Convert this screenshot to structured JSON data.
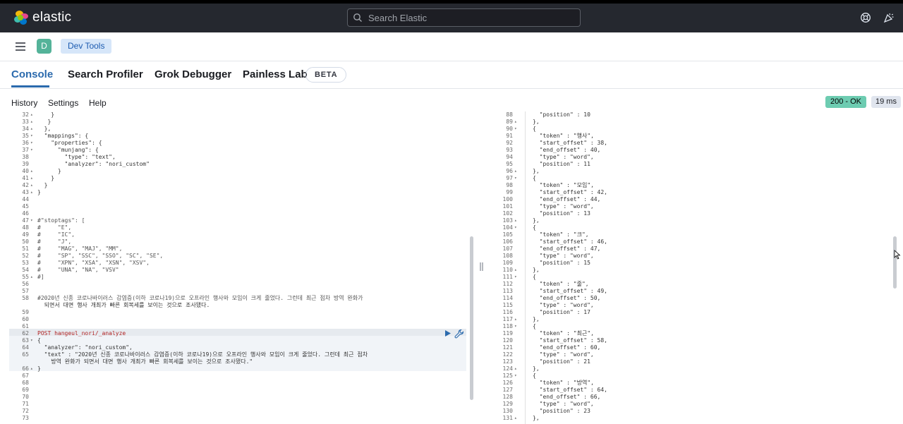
{
  "header": {
    "brand": "elastic",
    "search_placeholder": "Search Elastic"
  },
  "subheader": {
    "avatar_letter": "D",
    "breadcrumb": "Dev Tools"
  },
  "tabs": [
    {
      "label": "Console",
      "active": true
    },
    {
      "label": "Search Profiler",
      "active": false
    },
    {
      "label": "Grok Debugger",
      "active": false
    },
    {
      "label": "Painless Lab",
      "active": false
    }
  ],
  "beta_badge": "BETA",
  "toolbar": {
    "history": "History",
    "settings": "Settings",
    "help": "Help",
    "status": "200 - OK",
    "duration": "19 ms"
  },
  "colors": {
    "header_bg": "#25282f",
    "accent": "#2b6aad",
    "status_ok": "#6dccb1"
  },
  "editor_lines": [
    {
      "n": "32",
      "fold": "▴",
      "t": "    }"
    },
    {
      "n": "33",
      "fold": "▴",
      "t": "   }"
    },
    {
      "n": "34",
      "fold": "▴",
      "t": "  },"
    },
    {
      "n": "35",
      "fold": "▾",
      "t": "  \"mappings\": {"
    },
    {
      "n": "36",
      "fold": "▾",
      "t": "    \"properties\": {"
    },
    {
      "n": "37",
      "fold": "▾",
      "t": "      \"munjang\": {"
    },
    {
      "n": "38",
      "fold": "",
      "t": "        \"type\": \"text\","
    },
    {
      "n": "39",
      "fold": "",
      "t": "        \"analyzer\": \"nori_custom\""
    },
    {
      "n": "40",
      "fold": "▴",
      "t": "      }"
    },
    {
      "n": "41",
      "fold": "▴",
      "t": "    }"
    },
    {
      "n": "42",
      "fold": "▴",
      "t": "  }"
    },
    {
      "n": "43",
      "fold": "▴",
      "t": "}"
    },
    {
      "n": "44",
      "fold": "",
      "t": ""
    },
    {
      "n": "45",
      "fold": "",
      "t": ""
    },
    {
      "n": "46",
      "fold": "",
      "t": ""
    },
    {
      "n": "47",
      "fold": "▾",
      "t": "#\"stoptags\": ["
    },
    {
      "n": "48",
      "fold": "",
      "t": "#     \"E\","
    },
    {
      "n": "49",
      "fold": "",
      "t": "#     \"IC\","
    },
    {
      "n": "50",
      "fold": "",
      "t": "#     \"J\","
    },
    {
      "n": "51",
      "fold": "",
      "t": "#     \"MAG\", \"MAJ\", \"MM\","
    },
    {
      "n": "52",
      "fold": "",
      "t": "#     \"SP\", \"SSC\", \"SSO\", \"SC\", \"SE\","
    },
    {
      "n": "53",
      "fold": "",
      "t": "#     \"XPN\", \"XSA\", \"XSN\", \"XSV\","
    },
    {
      "n": "54",
      "fold": "",
      "t": "#     \"UNA\", \"NA\", \"VSV\""
    },
    {
      "n": "55",
      "fold": "▴",
      "t": "#]"
    },
    {
      "n": "56",
      "fold": "",
      "t": ""
    },
    {
      "n": "57",
      "fold": "",
      "t": ""
    },
    {
      "n": "58",
      "fold": "",
      "t": "#2020년 신종 코로나바이러스 감염증(이하 코로나19)으로 오프라인 행사와 모임이 크게 줄었다. 그런데 최근 점차 방역 완화가"
    },
    {
      "n": "",
      "fold": "",
      "t": "  되면서 대면 행사 개최가 빠른 회복세를 보이는 것으로 조사됐다."
    },
    {
      "n": "59",
      "fold": "",
      "t": ""
    },
    {
      "n": "60",
      "fold": "",
      "t": ""
    },
    {
      "n": "61",
      "fold": "",
      "t": ""
    },
    {
      "n": "62",
      "fold": "",
      "t": "POST hangeul_nori/_analyze"
    },
    {
      "n": "63",
      "fold": "▾",
      "t": "{"
    },
    {
      "n": "64",
      "fold": "",
      "t": "  \"analyzer\": \"nori_custom\","
    },
    {
      "n": "65",
      "fold": "",
      "t": "  \"text\" : \"2020년 신종 코로나바이러스 감염증(이하 코로나19)으로 오프라인 행사와 모임이 크게 줄었다. 그런데 최근 점차"
    },
    {
      "n": "",
      "fold": "",
      "t": "    방역 완화가 되면서 대면 행사 개최가 빠른 회복세를 보이는 것으로 조사됐다.\""
    },
    {
      "n": "66",
      "fold": "▴",
      "t": "}"
    },
    {
      "n": "67",
      "fold": "",
      "t": ""
    },
    {
      "n": "68",
      "fold": "",
      "t": ""
    },
    {
      "n": "69",
      "fold": "",
      "t": ""
    },
    {
      "n": "70",
      "fold": "",
      "t": ""
    },
    {
      "n": "71",
      "fold": "",
      "t": ""
    },
    {
      "n": "72",
      "fold": "",
      "t": ""
    },
    {
      "n": "73",
      "fold": "",
      "t": ""
    }
  ],
  "output_lines": [
    {
      "n": "88",
      "fold": "",
      "t": "  \"position\" : 10"
    },
    {
      "n": "89",
      "fold": "▴",
      "t": "},"
    },
    {
      "n": "90",
      "fold": "▾",
      "t": "{"
    },
    {
      "n": "91",
      "fold": "",
      "t": "  \"token\" : \"행사\","
    },
    {
      "n": "92",
      "fold": "",
      "t": "  \"start_offset\" : 38,"
    },
    {
      "n": "93",
      "fold": "",
      "t": "  \"end_offset\" : 40,"
    },
    {
      "n": "94",
      "fold": "",
      "t": "  \"type\" : \"word\","
    },
    {
      "n": "95",
      "fold": "",
      "t": "  \"position\" : 11"
    },
    {
      "n": "96",
      "fold": "▴",
      "t": "},"
    },
    {
      "n": "97",
      "fold": "▾",
      "t": "{"
    },
    {
      "n": "98",
      "fold": "",
      "t": "  \"token\" : \"모임\","
    },
    {
      "n": "99",
      "fold": "",
      "t": "  \"start_offset\" : 42,"
    },
    {
      "n": "100",
      "fold": "",
      "t": "  \"end_offset\" : 44,"
    },
    {
      "n": "101",
      "fold": "",
      "t": "  \"type\" : \"word\","
    },
    {
      "n": "102",
      "fold": "",
      "t": "  \"position\" : 13"
    },
    {
      "n": "103",
      "fold": "▴",
      "t": "},"
    },
    {
      "n": "104",
      "fold": "▾",
      "t": "{"
    },
    {
      "n": "105",
      "fold": "",
      "t": "  \"token\" : \"크\","
    },
    {
      "n": "106",
      "fold": "",
      "t": "  \"start_offset\" : 46,"
    },
    {
      "n": "107",
      "fold": "",
      "t": "  \"end_offset\" : 47,"
    },
    {
      "n": "108",
      "fold": "",
      "t": "  \"type\" : \"word\","
    },
    {
      "n": "109",
      "fold": "",
      "t": "  \"position\" : 15"
    },
    {
      "n": "110",
      "fold": "▴",
      "t": "},"
    },
    {
      "n": "111",
      "fold": "▾",
      "t": "{"
    },
    {
      "n": "112",
      "fold": "",
      "t": "  \"token\" : \"줄\","
    },
    {
      "n": "113",
      "fold": "",
      "t": "  \"start_offset\" : 49,"
    },
    {
      "n": "114",
      "fold": "",
      "t": "  \"end_offset\" : 50,"
    },
    {
      "n": "115",
      "fold": "",
      "t": "  \"type\" : \"word\","
    },
    {
      "n": "116",
      "fold": "",
      "t": "  \"position\" : 17"
    },
    {
      "n": "117",
      "fold": "▴",
      "t": "},"
    },
    {
      "n": "118",
      "fold": "▾",
      "t": "{"
    },
    {
      "n": "119",
      "fold": "",
      "t": "  \"token\" : \"최근\","
    },
    {
      "n": "120",
      "fold": "",
      "t": "  \"start_offset\" : 58,"
    },
    {
      "n": "121",
      "fold": "",
      "t": "  \"end_offset\" : 60,"
    },
    {
      "n": "122",
      "fold": "",
      "t": "  \"type\" : \"word\","
    },
    {
      "n": "123",
      "fold": "",
      "t": "  \"position\" : 21"
    },
    {
      "n": "124",
      "fold": "▴",
      "t": "},"
    },
    {
      "n": "125",
      "fold": "▾",
      "t": "{"
    },
    {
      "n": "126",
      "fold": "",
      "t": "  \"token\" : \"방역\","
    },
    {
      "n": "127",
      "fold": "",
      "t": "  \"start_offset\" : 64,"
    },
    {
      "n": "128",
      "fold": "",
      "t": "  \"end_offset\" : 66,"
    },
    {
      "n": "129",
      "fold": "",
      "t": "  \"type\" : \"word\","
    },
    {
      "n": "130",
      "fold": "",
      "t": "  \"position\" : 23"
    },
    {
      "n": "131",
      "fold": "▴",
      "t": "},"
    }
  ]
}
